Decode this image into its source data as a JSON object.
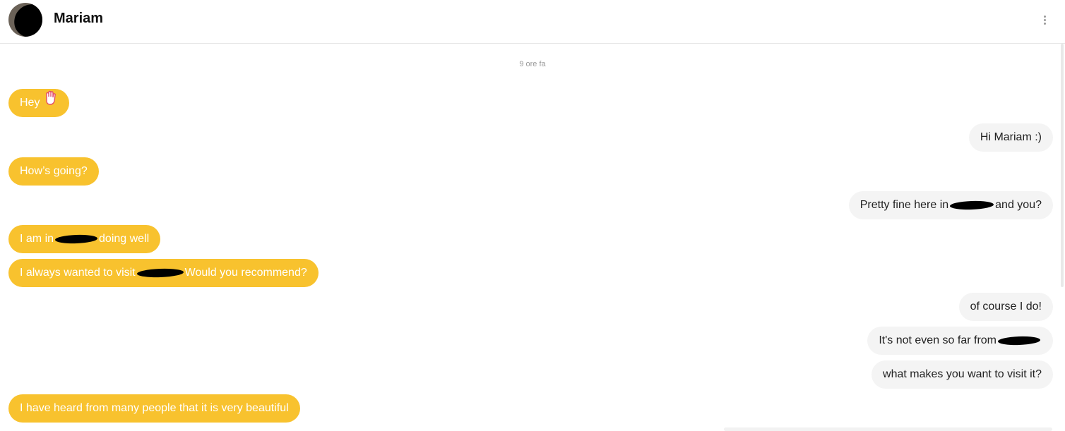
{
  "header": {
    "contact_name": "Mariam",
    "menu_icon": "more-vertical-icon"
  },
  "conversation": {
    "timestamp": "9 ore fa",
    "messages": [
      {
        "side": "in",
        "parts": [
          "Hey"
        ],
        "emoji": "waving-hand-icon"
      },
      {
        "side": "out",
        "parts": [
          "Hi Mariam :)"
        ]
      },
      {
        "side": "in",
        "parts": [
          "How’s going?"
        ]
      },
      {
        "side": "out",
        "parts": [
          "Pretty fine here in",
          "and you?"
        ]
      },
      {
        "side": "in",
        "parts": [
          "I am in",
          "doing well"
        ]
      },
      {
        "side": "in",
        "parts": [
          "I always wanted to visit",
          "Would you recommend?"
        ]
      },
      {
        "side": "out",
        "parts": [
          "of course I do!"
        ]
      },
      {
        "side": "out",
        "parts": [
          "It's not even so far from",
          ""
        ]
      },
      {
        "side": "out",
        "parts": [
          "what makes you want to visit it?"
        ]
      },
      {
        "side": "in",
        "parts": [
          "I have heard from many people that it is very beautiful"
        ]
      }
    ]
  },
  "colors": {
    "incoming_bubble": "#f8c22e",
    "outgoing_bubble": "#f4f4f4"
  }
}
